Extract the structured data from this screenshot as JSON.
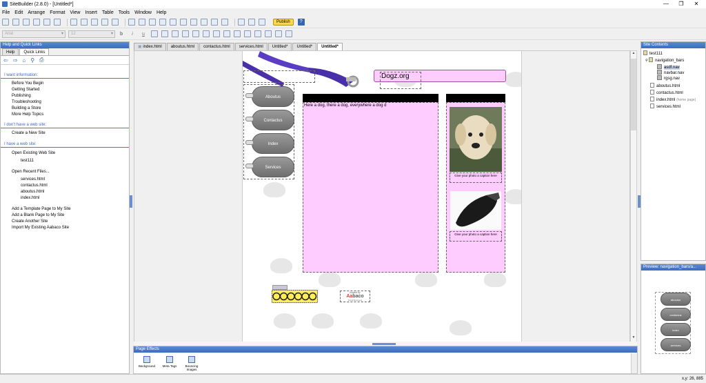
{
  "window": {
    "title": "SiteBuilder (2.8.0) - [Untitled*]",
    "controls": [
      "—",
      "❐",
      "✕"
    ]
  },
  "menu": [
    "File",
    "Edit",
    "Arrange",
    "Format",
    "View",
    "Insert",
    "Table",
    "Tools",
    "Window",
    "Help"
  ],
  "toolbar": {
    "publish_label": "Publish",
    "help_label": "?",
    "font_value": "Arial",
    "size_value": "12",
    "format_buttons": [
      "b",
      "i",
      "u"
    ]
  },
  "left_panel": {
    "header": "Help and Quick Links",
    "tabs": [
      "Help",
      "Quick Links"
    ],
    "nav_icons": [
      "⇦",
      "⇨",
      "⌂",
      "⚲",
      "⎙"
    ],
    "sections": [
      {
        "title": "I want information:",
        "items": [
          "Before You Begin",
          "Getting Started",
          "Publishing",
          "Troubleshooting",
          "Building a Store",
          "More Help Topics"
        ]
      },
      {
        "title": "I don't have a web site:",
        "items": [
          "Create a New Site"
        ]
      },
      {
        "title": "I have a web site:",
        "items": [
          "Open Existing Web Site"
        ]
      }
    ],
    "existing_site": "test111",
    "recent_label": "Open Recent Files...",
    "recent_files": [
      "services.html",
      "contactus.html",
      "aboutus.html",
      "index.html"
    ],
    "more_actions": [
      "Add a Template Page to My Site",
      "Add a Blank Page to My Site",
      "Create Another Site",
      "Import My Existing Aabaco Site"
    ]
  },
  "editor_tabs": [
    "index.html",
    "aboutus.html",
    "contactus.html",
    "services.html",
    "Untitled*",
    "Untitled*",
    "Untitled*"
  ],
  "page": {
    "site_title": "Dogz.org",
    "nav_buttons": [
      "Aboutus",
      "Contactus",
      "Index",
      "Services"
    ],
    "main_text": "Here a dog, there a dog, everywhere a dog d",
    "caption1": "Give your photo a caption here",
    "caption2": "Give your photo a caption here",
    "badge_small": "hosted by",
    "badge_brand_a": "Aa",
    "badge_brand_b": "baco",
    "badge_sub": "Small Business"
  },
  "page_effects": {
    "header": "Page Effects",
    "items": [
      "Background",
      "Meta Tags",
      "Bouncing Images"
    ]
  },
  "site_contents": {
    "header": "Site Contents",
    "root": "test111",
    "folder": "navigation_bars",
    "nav_files": [
      "asdf.nav",
      "navbar.nav",
      "rgsg.nav"
    ],
    "files": [
      "aboutus.html",
      "contactus.html",
      "index.html",
      "services.html"
    ],
    "home_note": "(home page)"
  },
  "preview": {
    "header": "Preview: navigation_bars/a...",
    "buttons": [
      "aboutus",
      "contactus",
      "index",
      "services"
    ]
  },
  "status": {
    "coords": "x,y: 26, 885"
  },
  "colors": {
    "accent": "#3d6cc0",
    "pink": "#ffccff",
    "publish": "#ffd84a"
  }
}
